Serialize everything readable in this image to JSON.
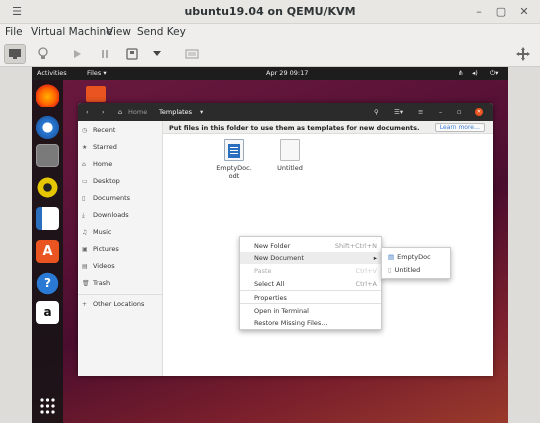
{
  "host": {
    "window_title": "ubuntu19.04 on QEMU/KVM",
    "menu": [
      "File",
      "Virtual Machine",
      "View",
      "Send Key"
    ]
  },
  "guest": {
    "topbar": {
      "activities": "Activities",
      "app": "Files ▾",
      "clock": "Apr 29  09:17"
    },
    "files": {
      "path_home": "Home",
      "path_current": "Templates",
      "banner_text": "Put files in this folder to use them as templates for new documents.",
      "banner_button": "Learn more…",
      "sidebar": [
        {
          "label": "Recent",
          "icon": "clock-icon"
        },
        {
          "label": "Starred",
          "icon": "star-icon"
        },
        {
          "label": "Home",
          "icon": "home-icon"
        },
        {
          "label": "Desktop",
          "icon": "desktop-icon"
        },
        {
          "label": "Documents",
          "icon": "document-icon"
        },
        {
          "label": "Downloads",
          "icon": "download-icon"
        },
        {
          "label": "Music",
          "icon": "music-icon"
        },
        {
          "label": "Pictures",
          "icon": "picture-icon"
        },
        {
          "label": "Videos",
          "icon": "video-icon"
        },
        {
          "label": "Trash",
          "icon": "trash-icon"
        },
        {
          "label": "Other Locations",
          "icon": "plus-icon"
        }
      ],
      "items": [
        {
          "name_line1": "EmptyDoc.",
          "name_line2": "odt"
        },
        {
          "name_line1": "Untitled",
          "name_line2": ""
        }
      ]
    },
    "context_menu": [
      {
        "label": "New Folder",
        "accel": "Shift+Ctrl+N"
      },
      {
        "label": "New Document",
        "accel": "▸"
      },
      {
        "label": "Paste",
        "accel": "Ctrl+V"
      },
      {
        "label": "Select All",
        "accel": "Ctrl+A"
      },
      {
        "label": "Properties",
        "accel": ""
      },
      {
        "label": "Open in Terminal",
        "accel": ""
      },
      {
        "label": "Restore Missing Files…",
        "accel": ""
      }
    ],
    "submenu": [
      {
        "label": "EmptyDoc"
      },
      {
        "label": "Untitled"
      }
    ]
  }
}
